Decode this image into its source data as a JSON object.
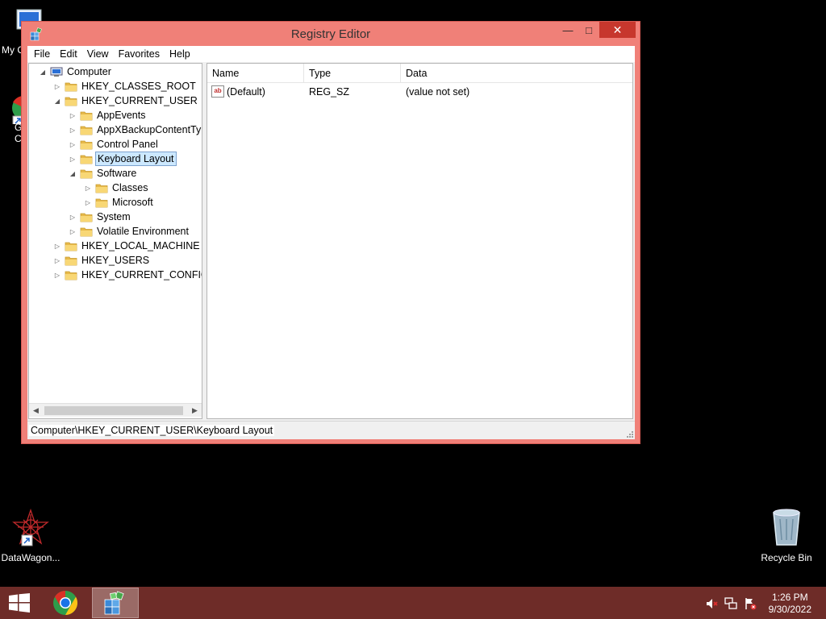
{
  "window": {
    "title": "Registry Editor",
    "minimize": "—",
    "maximize": "□",
    "close": "✕"
  },
  "menu": [
    "File",
    "Edit",
    "View",
    "Favorites",
    "Help"
  ],
  "tree": [
    {
      "label": "Computer",
      "depth": 0,
      "expander": "◢",
      "icon": "computer"
    },
    {
      "label": "HKEY_CLASSES_ROOT",
      "depth": 1,
      "expander": "▷",
      "icon": "folder"
    },
    {
      "label": "HKEY_CURRENT_USER",
      "depth": 1,
      "expander": "◢",
      "icon": "folder"
    },
    {
      "label": "AppEvents",
      "depth": 2,
      "expander": "▷",
      "icon": "folder"
    },
    {
      "label": "AppXBackupContentTyp",
      "depth": 2,
      "expander": "▷",
      "icon": "folder"
    },
    {
      "label": "Control Panel",
      "depth": 2,
      "expander": "▷",
      "icon": "folder"
    },
    {
      "label": "Keyboard Layout",
      "depth": 2,
      "expander": "▷",
      "icon": "folder",
      "selected": true
    },
    {
      "label": "Software",
      "depth": 2,
      "expander": "◢",
      "icon": "folder"
    },
    {
      "label": "Classes",
      "depth": 3,
      "expander": "▷",
      "icon": "folder"
    },
    {
      "label": "Microsoft",
      "depth": 3,
      "expander": "▷",
      "icon": "folder"
    },
    {
      "label": "System",
      "depth": 2,
      "expander": "▷",
      "icon": "folder"
    },
    {
      "label": "Volatile Environment",
      "depth": 2,
      "expander": "▷",
      "icon": "folder"
    },
    {
      "label": "HKEY_LOCAL_MACHINE",
      "depth": 1,
      "expander": "▷",
      "icon": "folder"
    },
    {
      "label": "HKEY_USERS",
      "depth": 1,
      "expander": "▷",
      "icon": "folder"
    },
    {
      "label": "HKEY_CURRENT_CONFIG",
      "depth": 1,
      "expander": "▷",
      "icon": "folder"
    }
  ],
  "scroll": {
    "left": "◀",
    "right": "▶"
  },
  "columns": [
    "Name",
    "Type",
    "Data"
  ],
  "values": [
    {
      "icon": "ab",
      "name": "(Default)",
      "type": "REG_SZ",
      "data": "(value not set)"
    }
  ],
  "status": "Computer\\HKEY_CURRENT_USER\\Keyboard Layout",
  "desktop": {
    "mycomputer_label": "My C",
    "chrome_label": "G\nC",
    "datawagon_label": "DataWagon...",
    "recycle_label": "Recycle Bin"
  },
  "clock": {
    "time": "1:26 PM",
    "date": "9/30/2022"
  },
  "colors": {
    "window_frame": "#f08078",
    "close": "#c7372d",
    "taskbar": "#6e2c28",
    "selection": "#cce8ff"
  }
}
